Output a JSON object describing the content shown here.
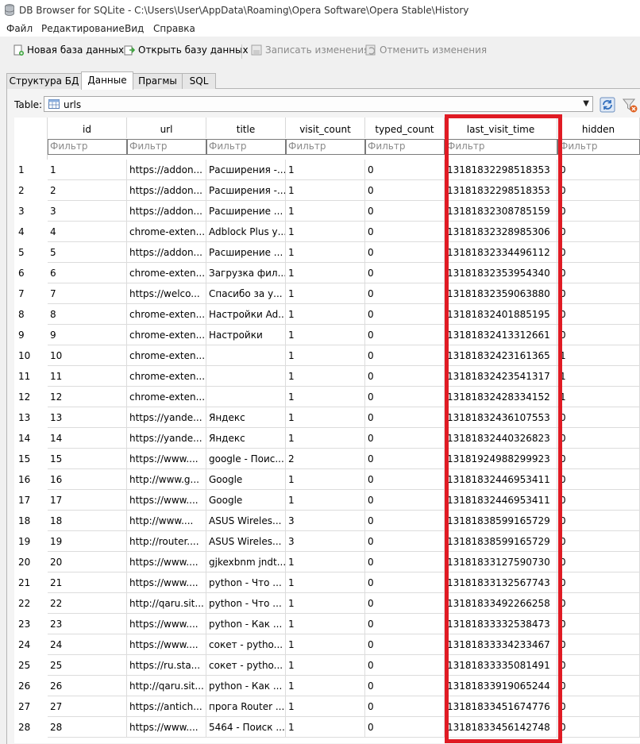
{
  "window": {
    "title": "DB Browser for SQLite - C:\\Users\\User\\AppData\\Roaming\\Opera Software\\Opera Stable\\History"
  },
  "menu": [
    "Файл",
    "Редактирование",
    "Вид",
    "Справка"
  ],
  "toolbar": {
    "new_db": "Новая база данных",
    "open_db": "Открыть базу данных",
    "write_changes": "Записать изменения",
    "revert_changes": "Отменить изменения"
  },
  "tabs": [
    "Структура БД",
    "Данные",
    "Прагмы",
    "SQL"
  ],
  "table_selector": {
    "label": "Table:",
    "value": "urls"
  },
  "columns": [
    "id",
    "url",
    "title",
    "visit_count",
    "typed_count",
    "last_visit_time",
    "hidden"
  ],
  "filter_placeholder": "Фильтр",
  "rows": [
    [
      "1",
      "https://addon...",
      "Расширения -...",
      "1",
      "0",
      "13181832298518353",
      "0"
    ],
    [
      "2",
      "https://addon...",
      "Расширения -...",
      "1",
      "0",
      "13181832298518353",
      "0"
    ],
    [
      "3",
      "https://addon...",
      "Расширение ...",
      "1",
      "0",
      "13181832308785159",
      "0"
    ],
    [
      "4",
      "chrome-exten...",
      "Adblock Plus у...",
      "1",
      "0",
      "13181832328985306",
      "0"
    ],
    [
      "5",
      "https://addon...",
      "Расширение ...",
      "1",
      "0",
      "13181832334496112",
      "0"
    ],
    [
      "6",
      "chrome-exten...",
      "Загрузка фил...",
      "1",
      "0",
      "13181832353954340",
      "0"
    ],
    [
      "7",
      "https://welco...",
      "Спасибо за у...",
      "1",
      "0",
      "13181832359063880",
      "0"
    ],
    [
      "8",
      "chrome-exten...",
      "Настройки Ad...",
      "1",
      "0",
      "13181832401885195",
      "0"
    ],
    [
      "9",
      "chrome-exten...",
      "Настройки",
      "1",
      "0",
      "13181832413312661",
      "0"
    ],
    [
      "10",
      "chrome-exten...",
      "",
      "1",
      "0",
      "13181832423161365",
      "1"
    ],
    [
      "11",
      "chrome-exten...",
      "",
      "1",
      "0",
      "13181832423541317",
      "1"
    ],
    [
      "12",
      "chrome-exten...",
      "",
      "1",
      "0",
      "13181832428334152",
      "1"
    ],
    [
      "13",
      "https://yande...",
      "Яндекс",
      "1",
      "0",
      "13181832436107553",
      "0"
    ],
    [
      "14",
      "https://yande...",
      "Яндекс",
      "1",
      "0",
      "13181832440326823",
      "0"
    ],
    [
      "15",
      "https://www....",
      "google - Поис...",
      "2",
      "0",
      "13181924988299923",
      "0"
    ],
    [
      "16",
      "http://www.g...",
      "Google",
      "1",
      "0",
      "13181832446953411",
      "0"
    ],
    [
      "17",
      "https://www....",
      "Google",
      "1",
      "0",
      "13181832446953411",
      "0"
    ],
    [
      "18",
      "http://www....",
      "ASUS Wireles...",
      "3",
      "0",
      "13181838599165729",
      "0"
    ],
    [
      "19",
      "http://router....",
      "ASUS Wireles...",
      "3",
      "0",
      "13181838599165729",
      "0"
    ],
    [
      "20",
      "https://www....",
      "gjkexbnm jndt...",
      "1",
      "0",
      "13181833127590730",
      "0"
    ],
    [
      "21",
      "https://www....",
      "python - Что ...",
      "1",
      "0",
      "13181833132567743",
      "0"
    ],
    [
      "22",
      "http://qaru.sit...",
      "python - Что ...",
      "1",
      "0",
      "13181833492266258",
      "0"
    ],
    [
      "23",
      "https://www....",
      "python - Как ...",
      "1",
      "0",
      "13181833332538473",
      "0"
    ],
    [
      "24",
      "https://www....",
      "сокет - pytho...",
      "1",
      "0",
      "13181833334233467",
      "0"
    ],
    [
      "25",
      "https://ru.sta...",
      "сокет - pytho...",
      "1",
      "0",
      "13181833335081491",
      "0"
    ],
    [
      "26",
      "http://qaru.sit...",
      "python - Как ...",
      "1",
      "0",
      "13181833919065244",
      "0"
    ],
    [
      "27",
      "https://antich...",
      "прога Router ...",
      "1",
      "0",
      "13181833451674776",
      "0"
    ],
    [
      "28",
      "https://www....",
      "5464 - Поиск ...",
      "1",
      "0",
      "13181833456142748",
      "0"
    ]
  ],
  "colors": {
    "highlight": "#e01b24"
  }
}
